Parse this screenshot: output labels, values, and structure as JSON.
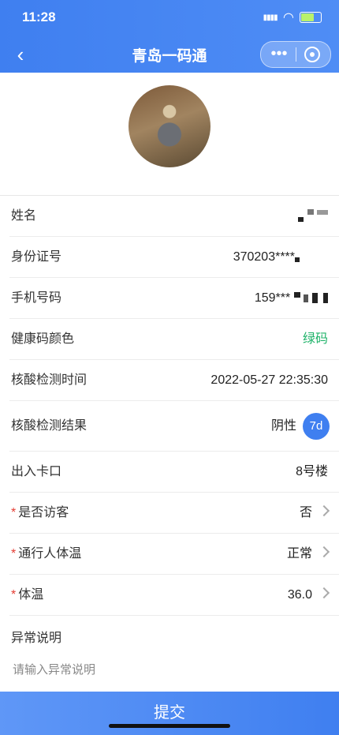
{
  "status_bar": {
    "time": "11:28",
    "signal": "▮▮▮▮",
    "wifi": "◠"
  },
  "nav": {
    "back_icon": "‹",
    "title": "青岛一码通",
    "more_icon": "•••"
  },
  "fields": [
    {
      "label": "姓名",
      "required": false,
      "value": ""
    },
    {
      "label": "身份证号",
      "required": false,
      "value": "370203****"
    },
    {
      "label": "手机号码",
      "required": false,
      "value": "159***"
    },
    {
      "label": "健康码颜色",
      "required": false,
      "value": "绿码"
    },
    {
      "label": "核酸检测时间",
      "required": false,
      "value": "2022-05-27 22:35:30"
    },
    {
      "label": "核酸检测结果",
      "required": false,
      "value": "阴性",
      "badge": "7d"
    },
    {
      "label": "出入卡口",
      "required": false,
      "value": "8号楼"
    },
    {
      "label": "是否访客",
      "required": true,
      "value": "否"
    },
    {
      "label": "通行人体温",
      "required": true,
      "value": "正常"
    },
    {
      "label": "体温",
      "required": true,
      "value": "36.0"
    }
  ],
  "required_mark": "*",
  "abnormal": {
    "label": "异常说明",
    "placeholder": "请输入异常说明"
  },
  "submit_label": "提交",
  "colors": {
    "primary": "#3f7ff0",
    "green_code": "#20b36a",
    "required": "#e43d33"
  }
}
